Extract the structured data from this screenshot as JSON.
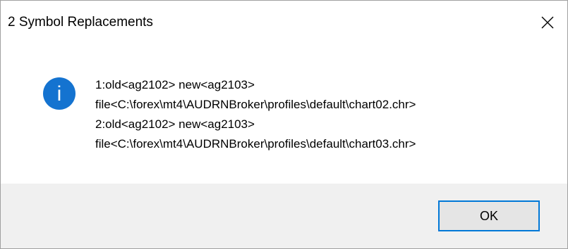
{
  "dialog": {
    "title": "2 Symbol Replacements",
    "close_icon": "close-icon",
    "info_icon": "info-icon",
    "info_icon_glyph": "i",
    "info_icon_color": "#1473d0",
    "message_lines": [
      "1:old<ag2102> new<ag2103>",
      "file<C:\\forex\\mt4\\AUDRNBroker\\profiles\\default\\chart02.chr>",
      "2:old<ag2102> new<ag2103>",
      "file<C:\\forex\\mt4\\AUDRNBroker\\profiles\\default\\chart03.chr>"
    ],
    "ok_label": "OK",
    "accent_color": "#0078d7",
    "footer_color": "#f0f0f0"
  }
}
